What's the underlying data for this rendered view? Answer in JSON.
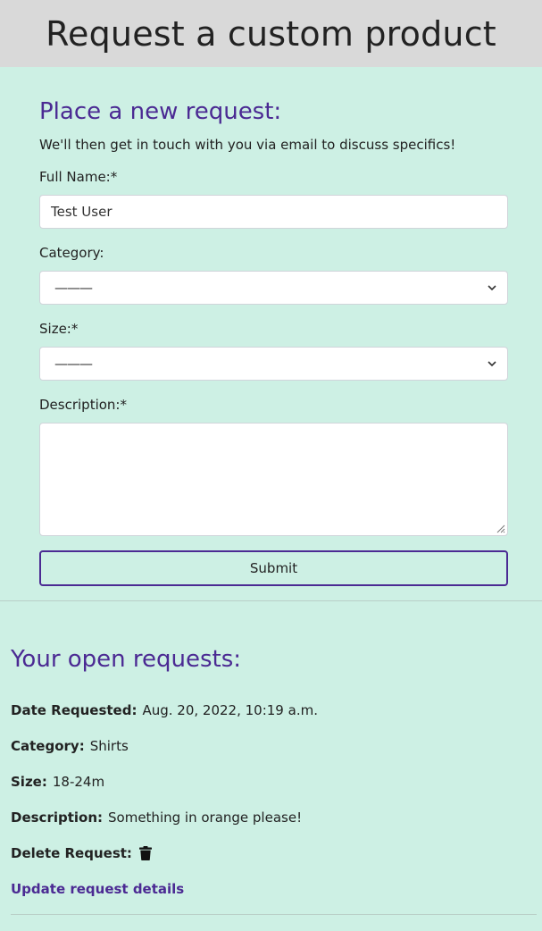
{
  "header": {
    "title": "Request a custom product"
  },
  "form": {
    "heading": "Place a new request:",
    "intro": "We'll then get in touch with you via email to discuss specifics!",
    "full_name": {
      "label": "Full Name:*",
      "value": "Test User"
    },
    "category": {
      "label": "Category:",
      "selected": "———"
    },
    "size": {
      "label": "Size:*",
      "selected": "———"
    },
    "description": {
      "label": "Description:*",
      "value": ""
    },
    "submit_label": "Submit"
  },
  "requests": {
    "heading": "Your open requests:",
    "date": {
      "label": "Date Requested:",
      "value": "Aug. 20, 2022, 10:19 a.m."
    },
    "category": {
      "label": "Category:",
      "value": "Shirts"
    },
    "size": {
      "label": "Size:",
      "value": "18-24m"
    },
    "description": {
      "label": "Description:",
      "value": "Something in orange please!"
    },
    "delete_label": "Delete Request:",
    "update_link": "Update request details"
  },
  "colors": {
    "accent": "#4b2a93",
    "background": "#cdf0e4",
    "header_bg": "#d9d9d9"
  },
  "icons": {
    "delete": "trash-icon",
    "dropdown": "chevron-down-icon",
    "resize": "resize-grip-icon"
  }
}
